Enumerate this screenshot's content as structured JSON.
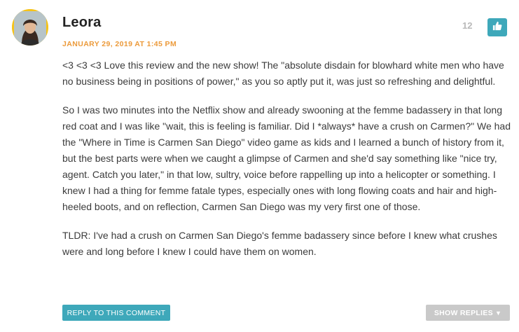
{
  "comment": {
    "author": "Leora",
    "timestamp": "JANUARY 29, 2019 AT 1:45 PM",
    "like_count": "12",
    "paragraphs": [
      "<3 <3 <3 Love this review and the new show! The \"absolute disdain for blowhard white men who have no business being in positions of power,\" as you so aptly put it, was just so refreshing and delightful.",
      "So I was two minutes into the Netflix show and already swooning at the femme badassery in that long red coat and I was like \"wait, this is feeling is familiar. Did I *always* have a crush on Carmen?\" We had the \"Where in Time is Carmen San Diego\" video game as kids and I learned a bunch of history from it, but the best parts were when we caught a glimpse of Carmen and she'd say something like \"nice try, agent. Catch you later,\" in that low, sultry, voice before rappelling up into a helicopter or something. I knew I had a thing for femme fatale types, especially ones with long flowing coats and hair and high-heeled boots, and on reflection, Carmen San Diego was my very first one of those.",
      "TLDR: I've had a crush on Carmen San Diego's femme badassery since before I knew what crushes were and long before I knew I could have them on women."
    ],
    "reply_label": "REPLY TO THIS COMMENT",
    "show_replies_label": "SHOW REPLIES",
    "show_replies_arrow": "▼"
  },
  "icons": {
    "like": "thumbs-up-icon",
    "avatar": "user-avatar"
  },
  "colors": {
    "accent": "#3ea8ba",
    "timestamp": "#ec9a3a",
    "avatar_ring": "#f5c31b",
    "muted_button": "#c9c9c9"
  }
}
